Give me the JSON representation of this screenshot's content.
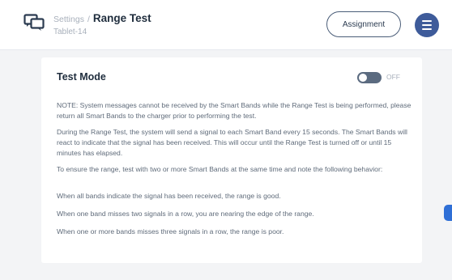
{
  "header": {
    "breadcrumb_parent": "Settings",
    "breadcrumb_separator": "/",
    "title": "Range Test",
    "subtitle": "Tablet-14",
    "assignment_label": "Assignment",
    "app_icon": "chat-bubbles-icon",
    "menu_icon": "hamburger-menu-icon"
  },
  "card": {
    "title": "Test Mode",
    "toggle_state": "OFF",
    "paragraphs": [
      "NOTE: System messages cannot be received by the Smart Bands while the Range Test is being performed, please return all Smart Bands to the charger prior to performing the test.",
      "During the Range Test, the system will send a signal to each Smart Band every 15 seconds. The Smart Bands will react to indicate that the signal has been received. This will occur until the Range Test is turned off or until 15 minutes has elapsed.",
      "To ensure the range, test with two or more Smart Bands at the same time and note the following behavior:",
      "When all bands indicate the signal has been received, the range is good.",
      "When one band misses two signals in a row, you are nearing the edge of the range.",
      "When one or more bands misses three signals in a row, the range is poor."
    ]
  },
  "colors": {
    "accent": "#3e5b9a",
    "toggle_off": "#5b6b80",
    "scroll_tab": "#2f6fd6"
  }
}
